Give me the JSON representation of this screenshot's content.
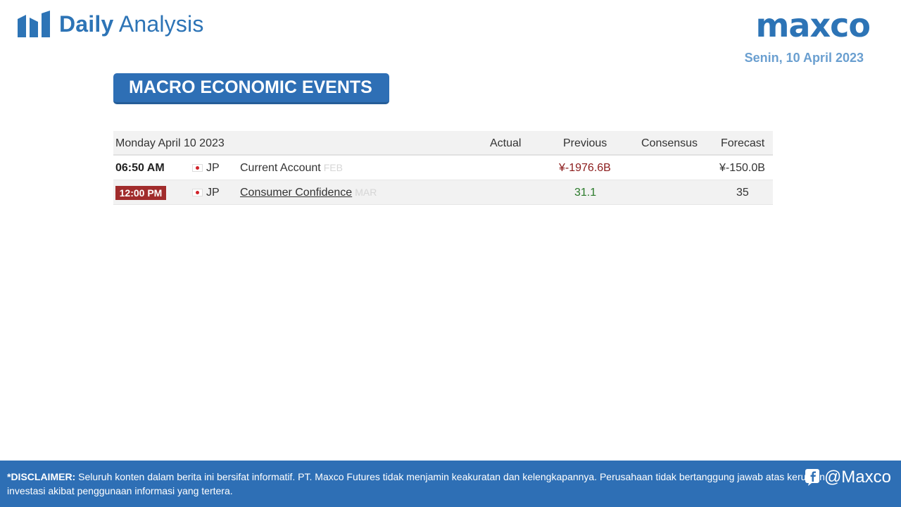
{
  "header": {
    "brand_bold": "Daily",
    "brand_light": "Analysis",
    "logo_text": "maxco",
    "date": "Senin, 10 April 2023"
  },
  "section": {
    "title": "MACRO ECONOMIC EVENTS"
  },
  "table": {
    "date_heading": "Monday April 10 2023",
    "columns": [
      "Actual",
      "Previous",
      "Consensus",
      "Forecast"
    ],
    "rows": [
      {
        "time": "06:50 AM",
        "country": "JP",
        "event": "Current Account",
        "period": "FEB",
        "actual": "",
        "previous": "¥-1976.6B",
        "consensus": "",
        "forecast": "¥-150.0B"
      },
      {
        "time": "12:00 PM",
        "country": "JP",
        "event": "Consumer Confidence",
        "period": "MAR",
        "actual": "",
        "previous": "31.1",
        "consensus": "",
        "forecast": "35"
      }
    ]
  },
  "footer": {
    "disclaimer_label": "*DISCLAIMER:",
    "disclaimer_text": "Seluruh konten dalam berita ini bersifat informatif. PT. Maxco Futures tidak menjamin keakuratan dan kelengkapannya. Perusahaan tidak bertanggung jawab atas kerugian investasi akibat penggunaan informasi yang tertera.",
    "social_handle": "@Maxco"
  },
  "colors": {
    "brand_blue": "#2e6fb5",
    "date_blue": "#6a9fd0",
    "time_badge": "#a12c2c",
    "negative": "#8b1b1b",
    "positive": "#2a7a2a"
  },
  "icons": {
    "brand": "bar-chart-icon",
    "flag": "japan-flag-icon",
    "social": "facebook-icon"
  }
}
